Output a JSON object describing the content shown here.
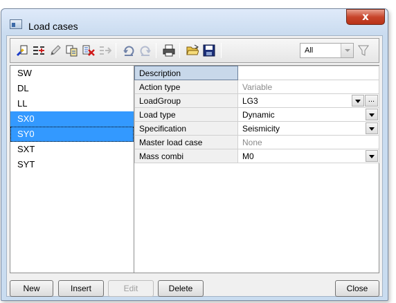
{
  "window": {
    "title": "Load cases",
    "close_label": "x"
  },
  "toolbar": {
    "buttons": [
      "new-case-icon",
      "insert-case-icon",
      "edit-icon",
      "copy-icon",
      "delete-icon",
      "disabled-insert-icon",
      "undo-icon",
      "redo-icon",
      "print-icon",
      "open-folder-icon",
      "save-icon"
    ],
    "filter": {
      "selected": "All"
    }
  },
  "cases": [
    {
      "label": "SW",
      "selected": false
    },
    {
      "label": "DL",
      "selected": false
    },
    {
      "label": "LL",
      "selected": false
    },
    {
      "label": "SX0",
      "selected": true
    },
    {
      "label": "SY0",
      "selected": true
    },
    {
      "label": "SXT",
      "selected": false
    },
    {
      "label": "SYT",
      "selected": false
    }
  ],
  "properties": [
    {
      "key": "Description",
      "value": "",
      "style": "header"
    },
    {
      "key": "Action type",
      "value": "Variable",
      "style": "gray"
    },
    {
      "key": "LoadGroup",
      "value": "LG3",
      "style": "dropdown-ellipsis"
    },
    {
      "key": "Load type",
      "value": "Dynamic",
      "style": "dropdown"
    },
    {
      "key": "Specification",
      "value": "Seismicity",
      "style": "dropdown"
    },
    {
      "key": "Master load case",
      "value": "None",
      "style": "gray"
    },
    {
      "key": "Mass combi",
      "value": "M0",
      "style": "dropdown"
    }
  ],
  "buttons": {
    "new": "New",
    "insert": "Insert",
    "edit": "Edit",
    "delete": "Delete",
    "close": "Close"
  },
  "colors": {
    "selection": "#3399ff",
    "close_button": "#c8452c"
  }
}
